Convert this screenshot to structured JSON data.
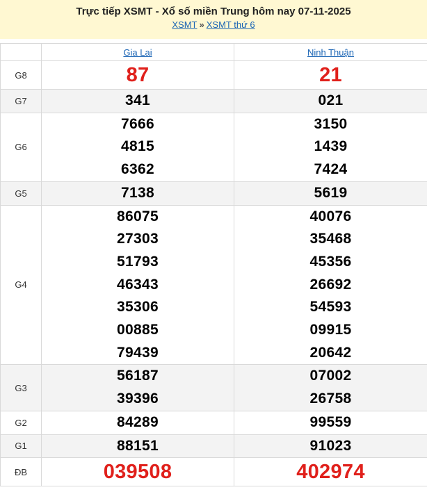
{
  "header": {
    "title": "Trực tiếp XSMT - Xổ số miền Trung hôm nay 07-11-2025",
    "crumb_home": "XSMT",
    "crumb_sep": "»",
    "crumb_day": "XSMT thứ 6"
  },
  "provinces": [
    "Gia Lai",
    "Ninh Thuận"
  ],
  "prizes": {
    "g8": {
      "label": "G8",
      "a": [
        "87"
      ],
      "b": [
        "21"
      ]
    },
    "g7": {
      "label": "G7",
      "a": [
        "341"
      ],
      "b": [
        "021"
      ]
    },
    "g6": {
      "label": "G6",
      "a": [
        "7666",
        "4815",
        "6362"
      ],
      "b": [
        "3150",
        "1439",
        "7424"
      ]
    },
    "g5": {
      "label": "G5",
      "a": [
        "7138"
      ],
      "b": [
        "5619"
      ]
    },
    "g4": {
      "label": "G4",
      "a": [
        "86075",
        "27303",
        "51793",
        "46343",
        "35306",
        "00885",
        "79439"
      ],
      "b": [
        "40076",
        "35468",
        "45356",
        "26692",
        "54593",
        "09915",
        "20642"
      ]
    },
    "g3": {
      "label": "G3",
      "a": [
        "56187",
        "39396"
      ],
      "b": [
        "07002",
        "26758"
      ]
    },
    "g2": {
      "label": "G2",
      "a": [
        "84289"
      ],
      "b": [
        "99559"
      ]
    },
    "g1": {
      "label": "G1",
      "a": [
        "88151"
      ],
      "b": [
        "91023"
      ]
    },
    "db": {
      "label": "ĐB",
      "a": [
        "039508"
      ],
      "b": [
        "402974"
      ]
    }
  },
  "colors": {
    "highlight": "#e0201b",
    "link": "#1a64b4",
    "header_bg": "#fff8d2",
    "alt_row": "#f3f3f3"
  }
}
